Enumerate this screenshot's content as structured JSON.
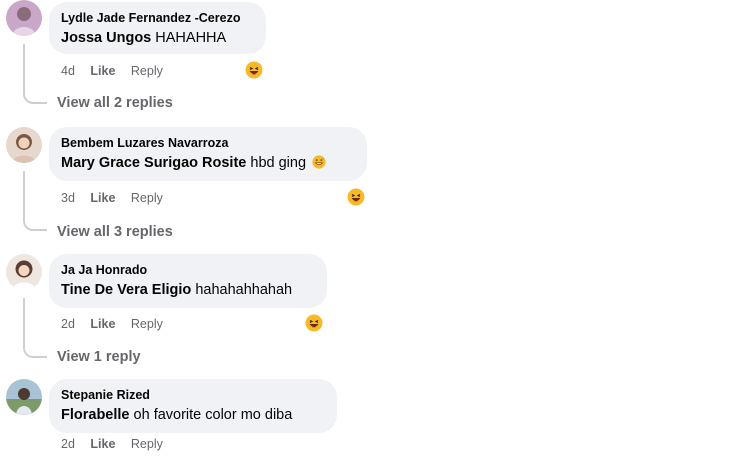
{
  "comments": [
    {
      "author": "Lydle Jade Fernandez -Cerezo",
      "mention": "Jossa Ungos",
      "text": "HAHAHHA",
      "time": "4d",
      "like": "Like",
      "reply": "Reply",
      "reaction": "laughing-emoji",
      "view_replies": "View all 2 replies"
    },
    {
      "author": "Bembem Luzares Navarroza",
      "mention": "Mary Grace Surigao Rosite",
      "text": "hbd ging",
      "inline_emoji": "grinning-sweat-emoji",
      "time": "3d",
      "like": "Like",
      "reply": "Reply",
      "reaction": "laughing-emoji",
      "view_replies": "View all 3 replies"
    },
    {
      "author": "Ja Ja Honrado",
      "mention": "Tine De Vera Eligio",
      "text": "hahahahhahah",
      "time": "2d",
      "like": "Like",
      "reply": "Reply",
      "reaction": "laughing-emoji",
      "view_replies": "View 1 reply"
    },
    {
      "author": "Stepanie Rized",
      "mention": "Florabelle",
      "text": "oh favorite color mo diba",
      "time": "2d",
      "like": "Like",
      "reply": "Reply"
    }
  ],
  "colors": {
    "bubble": "#f0f2f5",
    "secondary_text": "#65676b",
    "thread_line": "#ccd0d5"
  }
}
